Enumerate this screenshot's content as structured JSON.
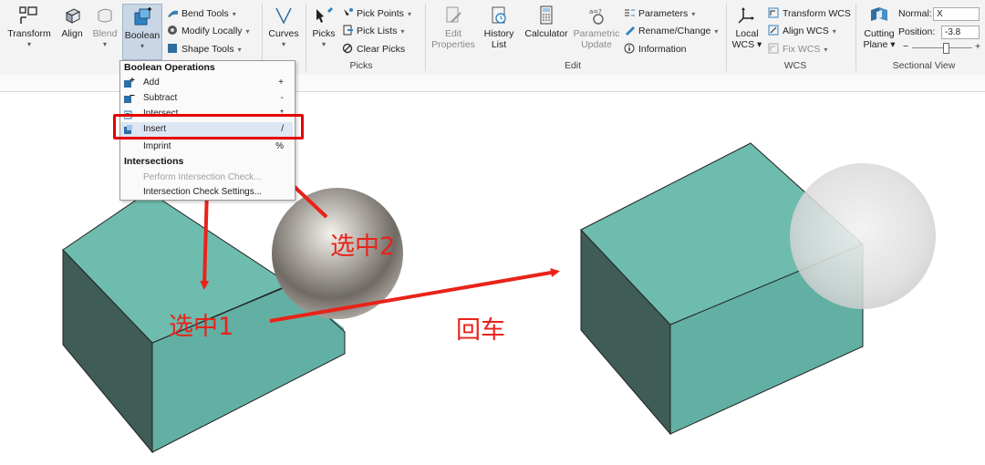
{
  "ribbon": {
    "transform_label": "Transform",
    "align_label": "Align",
    "blend_label": "Blend",
    "boolean_label": "Boolean",
    "bend_tools_label": "Bend Tools",
    "modify_locally_label": "Modify Locally",
    "shape_tools_label": "Shape Tools",
    "curves_label": "Curves",
    "picks_label": "Picks",
    "pick_points_label": "Pick Points",
    "pick_lists_label": "Pick Lists",
    "clear_picks_label": "Clear Picks",
    "picks_group": "Picks",
    "edit_properties_label": "Edit\nProperties",
    "edit_label1": "Edit",
    "edit_label2": "Properties",
    "history_label1": "History",
    "history_label2": "List",
    "calculator_label": "Calculator",
    "parametric_label1": "Parametric",
    "parametric_label2": "Update",
    "parameters_label": "Parameters",
    "rename_label": "Rename/Change",
    "information_label": "Information",
    "edit_group": "Edit",
    "local_label1": "Local",
    "local_label2": "WCS",
    "transform_wcs_label": "Transform WCS",
    "align_wcs_label": "Align WCS",
    "fix_wcs_label": "Fix WCS",
    "wcs_group": "WCS",
    "cutting_label1": "Cutting",
    "cutting_label2": "Plane",
    "normal_label": "Normal:",
    "normal_value": "X",
    "position_label": "Position:",
    "position_value": "-3.8",
    "sectional_group": "Sectional View",
    "minus": "−",
    "plus": "+"
  },
  "menu": {
    "boolean_header": "Boolean Operations",
    "items": [
      {
        "label": "Add",
        "key": "+"
      },
      {
        "label": "Subtract",
        "key": "-"
      },
      {
        "label": "Intersect",
        "key": "*"
      },
      {
        "label": "Insert",
        "key": "/"
      },
      {
        "label": "Imprint",
        "key": "%"
      }
    ],
    "intersections_header": "Intersections",
    "perform_check": "Perform Intersection Check...",
    "check_settings": "Intersection Check Settings..."
  },
  "annotations": {
    "select1": "选中1",
    "select2": "选中2",
    "enter": "回车"
  },
  "colors": {
    "box_top": "#6ebcae",
    "box_front": "#62b0a3",
    "box_side": "#3f5c57",
    "accent_red": "#e8231a"
  }
}
